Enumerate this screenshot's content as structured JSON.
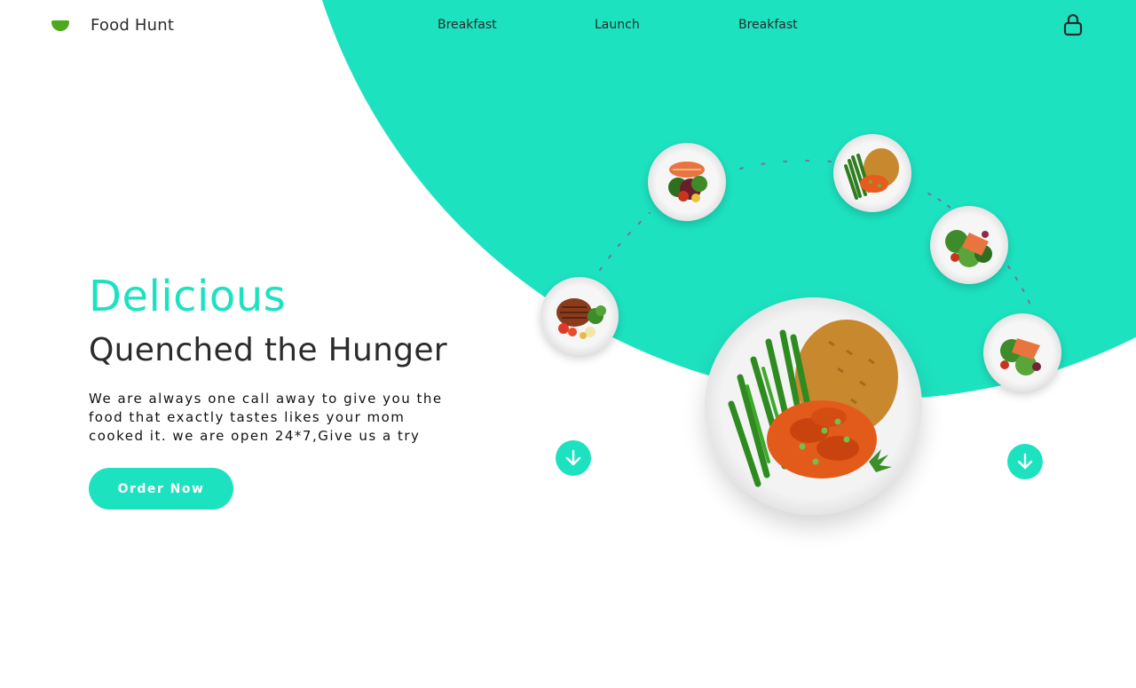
{
  "brand": {
    "name": "Food Hunt",
    "icon": "bowl-icon",
    "color": "#4aaa1b"
  },
  "nav": {
    "items": [
      {
        "label": "Breakfast"
      },
      {
        "label": "Launch"
      },
      {
        "label": "Breakfast"
      }
    ],
    "cart_icon": "shopping-bag-icon"
  },
  "hero": {
    "title": "Delicious",
    "subtitle": "Quenched the Hunger",
    "description": "We are always one call away to give you the food that exactly tastes likes your mom cooked it. we are open 24*7,Give us a try",
    "cta_label": "Order Now"
  },
  "carousel": {
    "prev_icon": "arrow-down-icon",
    "next_icon": "arrow-down-icon"
  },
  "colors": {
    "accent": "#1de2c0",
    "text": "#2b2b2b",
    "brand_green": "#4aaa1b"
  }
}
